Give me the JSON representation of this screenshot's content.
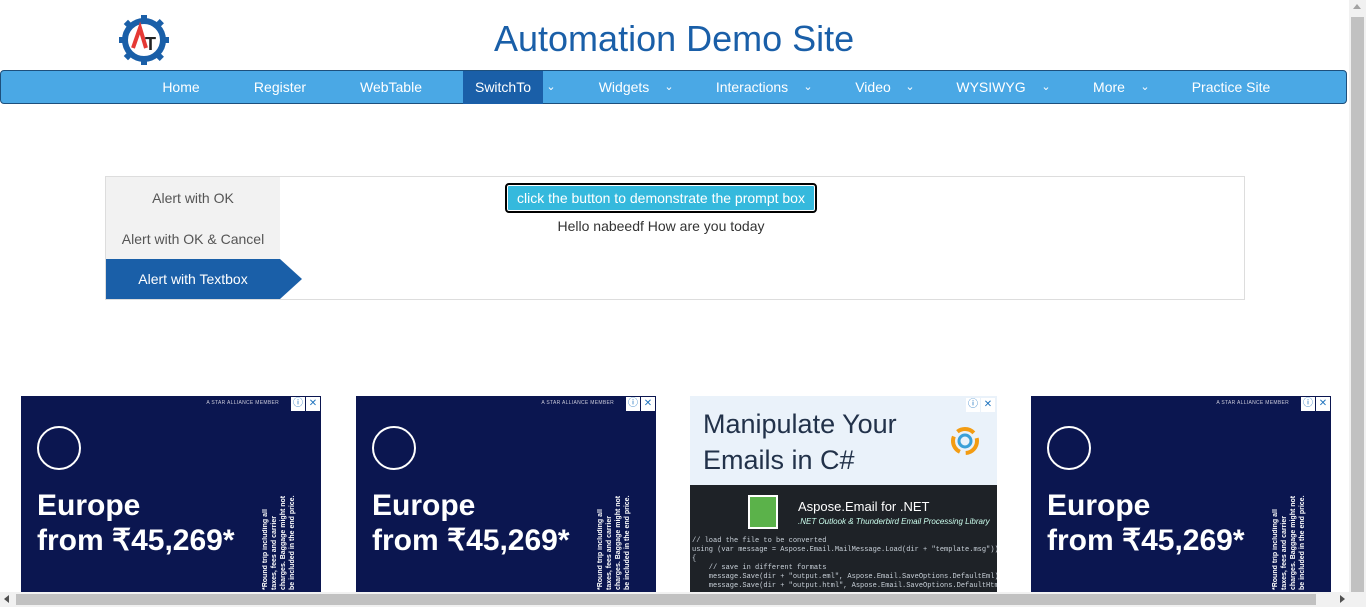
{
  "header": {
    "site_title": "Automation Demo Site",
    "logo_letters": "AT",
    "logo_icon": "gear-logo-icon"
  },
  "navbar": {
    "items": [
      {
        "label": "Home",
        "dropdown": false,
        "active": false
      },
      {
        "label": "Register",
        "dropdown": false,
        "active": false
      },
      {
        "label": "WebTable",
        "dropdown": false,
        "active": false
      },
      {
        "label": "SwitchTo",
        "dropdown": true,
        "active": true
      },
      {
        "label": "Widgets",
        "dropdown": true,
        "active": false
      },
      {
        "label": "Interactions",
        "dropdown": true,
        "active": false
      },
      {
        "label": "Video",
        "dropdown": true,
        "active": false
      },
      {
        "label": "WYSIWYG",
        "dropdown": true,
        "active": false
      },
      {
        "label": "More",
        "dropdown": true,
        "active": false
      },
      {
        "label": "Practice Site",
        "dropdown": false,
        "active": false
      }
    ],
    "caret_icon": "chevron-down-icon"
  },
  "alerts": {
    "tabs": [
      {
        "label": "Alert with OK",
        "active": false
      },
      {
        "label": "Alert with OK & Cancel",
        "active": false
      },
      {
        "label": "Alert with Textbox",
        "active": true
      }
    ],
    "button_label": "click the button to demonstrate the prompt box",
    "result_text": "Hello nabeedf How are you today"
  },
  "ads": [
    {
      "variant": "dark",
      "top_text": "A STAR ALLIANCE MEMBER",
      "line1": "Europe",
      "line2": "from ₹45,269*",
      "side_text": "*Round trip including all taxes, fees and carrier charges. Baggage might not be included in the end price."
    },
    {
      "variant": "dark",
      "top_text": "A STAR ALLIANCE MEMBER",
      "line1": "Europe",
      "line2": "from ₹45,269*",
      "side_text": "*Round trip including all taxes, fees and carrier charges. Baggage might not be included in the end price."
    },
    {
      "variant": "light",
      "line1": "Manipulate Your",
      "line2": "Emails in C#",
      "brand": "Aspose.Email for .NET",
      "sub": ".NET Outlook & Thunderbird Email Processing Library",
      "code": "// load the file to be converted\nusing (var message = Aspose.Email.MailMessage.Load(dir + \"template.msg\"))\n{\n    // save in different formats\n    message.Save(dir + \"output.eml\", Aspose.Email.SaveOptions.DefaultEml);\n    message.Save(dir + \"output.html\", Aspose.Email.SaveOptions.DefaultHtml);"
    },
    {
      "variant": "dark",
      "top_text": "A STAR ALLIANCE MEMBER",
      "line1": "Europe",
      "line2": "from ₹45,269*",
      "side_text": "*Round trip including all taxes, fees and carrier charges. Baggage might not be included in the end price."
    }
  ],
  "ad_controls": {
    "info_icon": "info-icon",
    "close_icon": "close-icon"
  },
  "colors": {
    "title": "#1a5fa8",
    "navbar": "#4aa8e5",
    "nav_active": "#1a5fa8",
    "button": "#35b9dd",
    "ad_dark": "#0b1650"
  }
}
